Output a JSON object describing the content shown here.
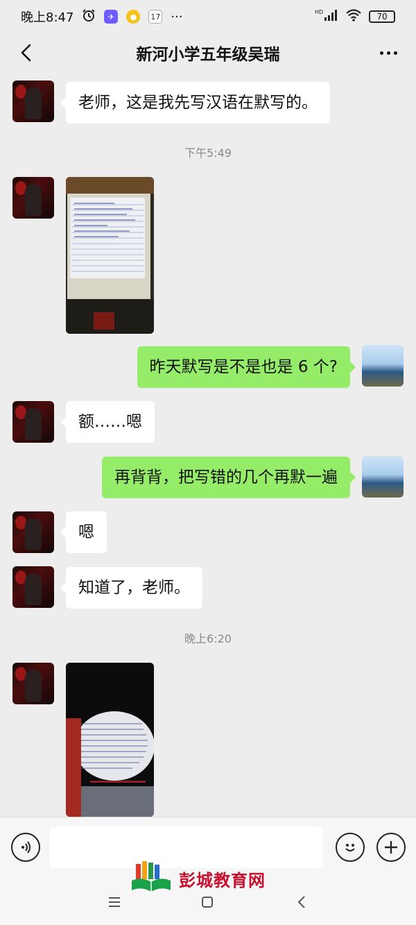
{
  "status_bar": {
    "time": "晚上8:47",
    "calendar_day": "17",
    "more": "···",
    "network": "HD",
    "battery": "70"
  },
  "header": {
    "title": "新河小学五年级吴瑞"
  },
  "messages": [
    {
      "side": "left",
      "text": "老师，这是我先写汉语在默写的。"
    },
    {
      "timestamp": "下午5:49"
    },
    {
      "side": "left",
      "type": "image"
    },
    {
      "side": "right",
      "text": "昨天默写是不是也是 6 个?"
    },
    {
      "side": "left",
      "text": "额……嗯"
    },
    {
      "side": "right",
      "text": "再背背，把写错的几个再默一遍"
    },
    {
      "side": "left",
      "text": "嗯"
    },
    {
      "side": "left",
      "text": "知道了，老师。"
    },
    {
      "timestamp": "晚上6:20"
    },
    {
      "side": "left",
      "type": "image"
    }
  ],
  "m1": "老师，这是我先写汉语在默写的。",
  "ts1": "下午5:49",
  "m3": "昨天默写是不是也是 6 个?",
  "m4": "额……嗯",
  "m5": "再背背，把写错的几个再默一遍",
  "m6": "嗯",
  "m7": "知道了，老师。",
  "ts2": "晚上6:20",
  "input_bar": {
    "voice_icon": "voice-icon",
    "emoji_icon": "emoji-icon",
    "add_icon": "plus-icon"
  },
  "watermark": {
    "text": "彭城教育网"
  },
  "colors": {
    "background": "#ededed",
    "bubble_self": "#95ec69",
    "bubble_other": "#ffffff",
    "watermark": "#c8102e"
  }
}
